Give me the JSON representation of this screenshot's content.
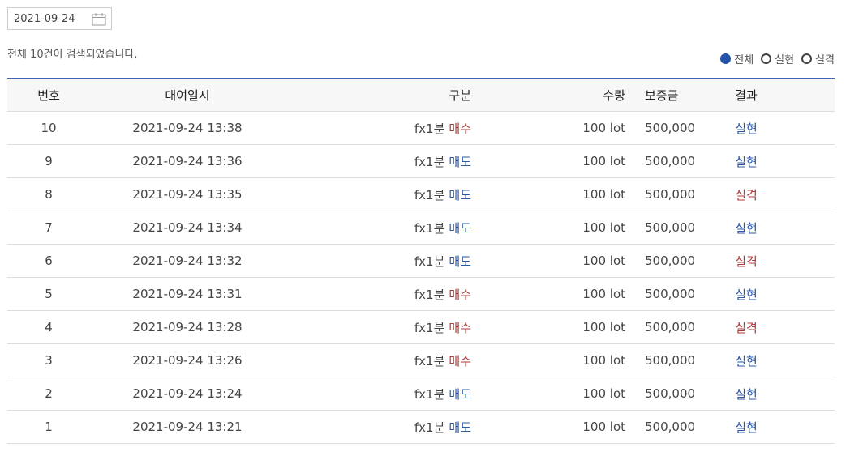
{
  "date_picker": {
    "value": "2021-09-24"
  },
  "result_count_text": "전체 10건이 검색되었습니다.",
  "filters": [
    {
      "label": "전체",
      "selected": true
    },
    {
      "label": "실현",
      "selected": false
    },
    {
      "label": "실격",
      "selected": false
    }
  ],
  "table": {
    "headers": [
      "번호",
      "대여일시",
      "구분",
      "수량",
      "보증금",
      "결과"
    ],
    "rows": [
      {
        "no": "10",
        "datetime": "2021-09-24 13:38",
        "product": "fx1분",
        "side": "매수",
        "qty": "100 lot",
        "deposit": "500,000",
        "result": "실현"
      },
      {
        "no": "9",
        "datetime": "2021-09-24 13:36",
        "product": "fx1분",
        "side": "매도",
        "qty": "100 lot",
        "deposit": "500,000",
        "result": "실현"
      },
      {
        "no": "8",
        "datetime": "2021-09-24 13:35",
        "product": "fx1분",
        "side": "매도",
        "qty": "100 lot",
        "deposit": "500,000",
        "result": "실격"
      },
      {
        "no": "7",
        "datetime": "2021-09-24 13:34",
        "product": "fx1분",
        "side": "매도",
        "qty": "100 lot",
        "deposit": "500,000",
        "result": "실현"
      },
      {
        "no": "6",
        "datetime": "2021-09-24 13:32",
        "product": "fx1분",
        "side": "매도",
        "qty": "100 lot",
        "deposit": "500,000",
        "result": "실격"
      },
      {
        "no": "5",
        "datetime": "2021-09-24 13:31",
        "product": "fx1분",
        "side": "매수",
        "qty": "100 lot",
        "deposit": "500,000",
        "result": "실현"
      },
      {
        "no": "4",
        "datetime": "2021-09-24 13:28",
        "product": "fx1분",
        "side": "매수",
        "qty": "100 lot",
        "deposit": "500,000",
        "result": "실격"
      },
      {
        "no": "3",
        "datetime": "2021-09-24 13:26",
        "product": "fx1분",
        "side": "매수",
        "qty": "100 lot",
        "deposit": "500,000",
        "result": "실현"
      },
      {
        "no": "2",
        "datetime": "2021-09-24 13:24",
        "product": "fx1분",
        "side": "매도",
        "qty": "100 lot",
        "deposit": "500,000",
        "result": "실현"
      },
      {
        "no": "1",
        "datetime": "2021-09-24 13:21",
        "product": "fx1분",
        "side": "매도",
        "qty": "100 lot",
        "deposit": "500,000",
        "result": "실현"
      }
    ]
  },
  "colors": {
    "buy": "#b03a3a",
    "sell": "#2b57a6",
    "realized": "#2b57a6",
    "disqualified": "#b03a3a",
    "header_border": "#3a66b8"
  }
}
